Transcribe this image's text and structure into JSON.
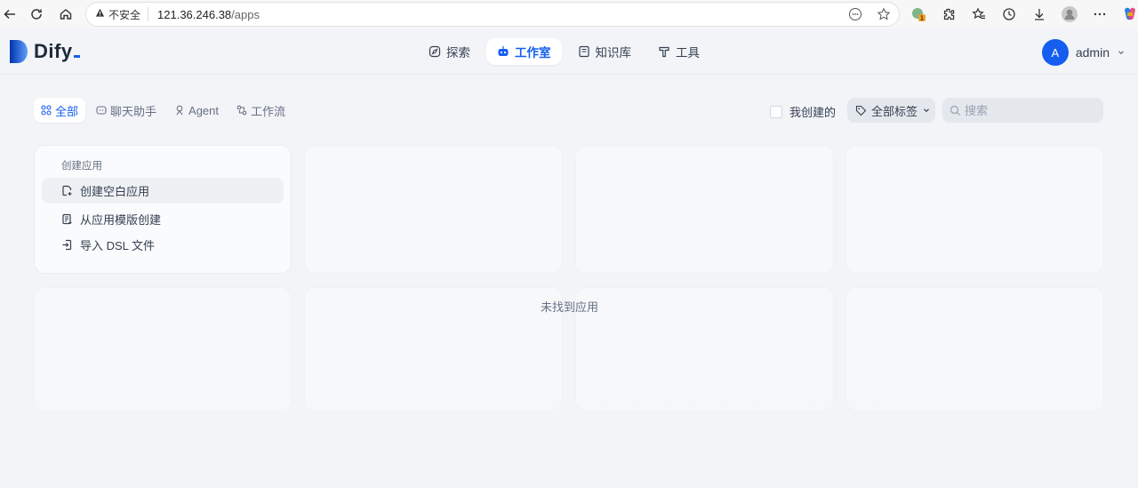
{
  "browser": {
    "insecure_label": "不安全",
    "url_host": "121.36.246.38",
    "url_path": "/apps"
  },
  "app": {
    "logo_text": "Dify",
    "brand_color": "#155eef"
  },
  "nav": {
    "items": [
      {
        "label": "探索",
        "icon": "compass-icon"
      },
      {
        "label": "工作室",
        "icon": "robot-icon",
        "active": true
      },
      {
        "label": "知识库",
        "icon": "book-icon"
      },
      {
        "label": "工具",
        "icon": "hammer-icon"
      }
    ]
  },
  "user": {
    "avatar_letter": "A",
    "name": "admin"
  },
  "filters": {
    "tabs": [
      {
        "label": "全部",
        "icon": "grid-icon",
        "active": true
      },
      {
        "label": "聊天助手",
        "icon": "chat-icon"
      },
      {
        "label": "Agent",
        "icon": "agent-icon"
      },
      {
        "label": "工作流",
        "icon": "workflow-icon"
      }
    ],
    "mine_label": "我创建的",
    "tag_label": "全部标签",
    "search_placeholder": "搜索"
  },
  "create": {
    "title": "创建应用",
    "options": [
      {
        "label": "创建空白应用",
        "icon": "file-plus-icon"
      },
      {
        "label": "从应用模版创建",
        "icon": "template-icon"
      },
      {
        "label": "导入 DSL 文件",
        "icon": "import-icon"
      }
    ]
  },
  "empty_state": "未找到应用"
}
